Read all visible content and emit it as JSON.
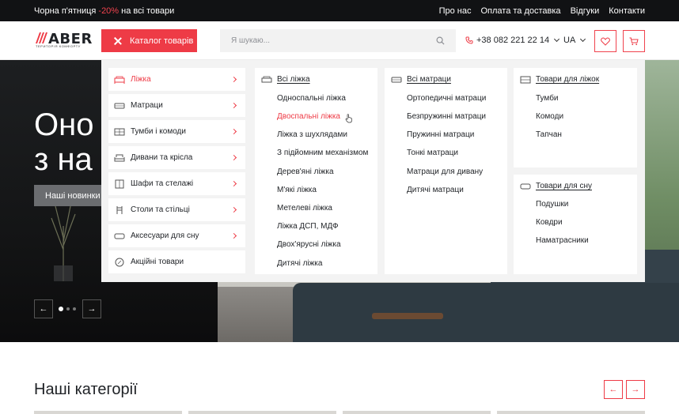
{
  "topbar": {
    "promo_prefix": "Чорна п'ятниця",
    "promo_accent": "-20%",
    "promo_suffix": "на всі товари",
    "links": [
      "Про нас",
      "Оплата та доставка",
      "Відгуки",
      "Контакти"
    ]
  },
  "header": {
    "logo_text": "ABER",
    "logo_sub": "ТЕРИТОРІЯ КОМФОРТУ",
    "catalog_label": "Каталог товарів",
    "search_placeholder": "Я шукаю...",
    "phone": "+38 082 221 22 14",
    "lang": "UA"
  },
  "hero": {
    "title": "Оно\nз на",
    "button": "Наші новинки",
    "prev": "←",
    "next": "→",
    "slides": 3,
    "active_slide": 1
  },
  "menu": {
    "sidebar": [
      {
        "label": "Ліжка",
        "icon": "bed-icon",
        "active": true
      },
      {
        "label": "Матраци",
        "icon": "mattress-icon"
      },
      {
        "label": "Тумби і комоди",
        "icon": "dresser-icon"
      },
      {
        "label": "Дивани та крісла",
        "icon": "sofa-icon"
      },
      {
        "label": "Шафи та стелажі",
        "icon": "wardrobe-icon"
      },
      {
        "label": "Столи та стільці",
        "icon": "chair-icon"
      },
      {
        "label": "Аксесуари для сну",
        "icon": "pillow-icon"
      },
      {
        "label": "Акційні товари",
        "icon": "discount-icon"
      }
    ],
    "beds": {
      "heading": "Всі ліжка",
      "items": [
        "Односпальні ліжка",
        "Двоспальні ліжка",
        "Ліжка з шухлядами",
        "З підйомним механізмом",
        "Дерев'яні ліжка",
        "М'які ліжка",
        "Метелеві ліжка",
        "Ліжка ДСП, МДФ",
        "Двох'ярусні ліжка",
        "Дитячі ліжка"
      ],
      "highlighted": 1
    },
    "mattresses": {
      "heading": "Всі матраци",
      "items": [
        "Ортопедичні матраци",
        "Безпружинні матраци",
        "Пружинні матраци",
        "Тонкі матраци",
        "Матраци для дивану",
        "Дитячі матраци"
      ]
    },
    "for_beds": {
      "heading": "Товари для ліжок",
      "items": [
        "Тумби",
        "Комоди",
        "Тапчан"
      ]
    },
    "for_sleep": {
      "heading": "Товари для сну",
      "items": [
        "Подушки",
        "Ковдри",
        "Наматрасники"
      ]
    }
  },
  "categories": {
    "title": "Наші категорії",
    "prev": "←",
    "next": "→"
  },
  "colors": {
    "accent": "#ee3b46",
    "dark": "#111214"
  }
}
